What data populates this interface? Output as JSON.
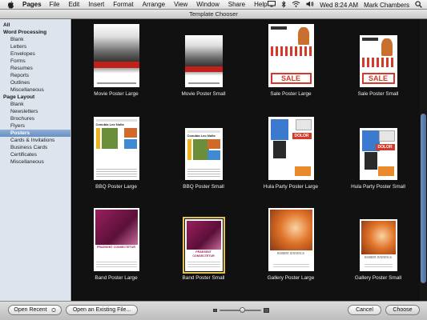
{
  "menubar": {
    "app_name": "Pages",
    "items": [
      "File",
      "Edit",
      "Insert",
      "Format",
      "Arrange",
      "View",
      "Window",
      "Share",
      "Help"
    ],
    "clock": "Wed 8:24 AM",
    "user": "Mark Chambers"
  },
  "window": {
    "title": "Template Chooser"
  },
  "sidebar": {
    "items": [
      {
        "label": "All",
        "header": true
      },
      {
        "label": "Word Processing",
        "header": true
      },
      {
        "label": "Blank"
      },
      {
        "label": "Letters"
      },
      {
        "label": "Envelopes"
      },
      {
        "label": "Forms"
      },
      {
        "label": "Resumes"
      },
      {
        "label": "Reports"
      },
      {
        "label": "Outlines"
      },
      {
        "label": "Miscellaneous"
      },
      {
        "label": "Page Layout",
        "header": true
      },
      {
        "label": "Blank"
      },
      {
        "label": "Newsletters"
      },
      {
        "label": "Brochures"
      },
      {
        "label": "Flyers"
      },
      {
        "label": "Posters",
        "selected": true
      },
      {
        "label": "Cards & Invitations"
      },
      {
        "label": "Business Cards"
      },
      {
        "label": "Certificates"
      },
      {
        "label": "Miscellaneous"
      }
    ]
  },
  "templates": [
    {
      "name": "Movie Poster Large",
      "kind": "movie"
    },
    {
      "name": "Movie Poster Small",
      "kind": "movie"
    },
    {
      "name": "Sale Poster Large",
      "kind": "sale"
    },
    {
      "name": "Sale Poster Small",
      "kind": "sale"
    },
    {
      "name": "BBQ Poster Large",
      "kind": "bbq",
      "heading": "Conubia Leo Nulla"
    },
    {
      "name": "BBQ Poster Small",
      "kind": "bbq",
      "heading": "Conubia Leo Nulla"
    },
    {
      "name": "Hula Party Poster Large",
      "kind": "hula",
      "heading": "DOLOR"
    },
    {
      "name": "Hula Party Poster Small",
      "kind": "hula",
      "heading": "DOLOR"
    },
    {
      "name": "Band Poster Large",
      "kind": "band",
      "heading": "PRAESENT CONSECTETUR"
    },
    {
      "name": "Band Poster Small",
      "kind": "band",
      "heading": "PRAESENT CONSECTETUR",
      "selected": true
    },
    {
      "name": "Gallery Poster Large",
      "kind": "gallery",
      "heading": "ROBERT JENNINGS"
    },
    {
      "name": "Gallery Poster Small",
      "kind": "gallery",
      "heading": "ROBERT JENNINGS"
    }
  ],
  "buttons": {
    "open_recent": "Open Recent",
    "open_existing": "Open an Existing File...",
    "cancel": "Cancel",
    "choose": "Choose"
  },
  "icons": {
    "apple": "apple-icon",
    "display": "display-icon",
    "bluetooth": "bluetooth-icon",
    "wifi": "wifi-icon",
    "volume": "volume-icon",
    "spotlight": "search-icon",
    "thumb_small": "small-thumbnail-icon",
    "thumb_large": "large-thumbnail-icon"
  },
  "colors": {
    "selection_outline": "#e3c14b",
    "sidebar_selection": "#6a8fc2",
    "grid_background": "#111111",
    "sale_red": "#d23a2a",
    "gallery_orange": "#e0742a",
    "band_magenta": "#9b1f5e"
  },
  "zoom": {
    "thumbnail_size_fraction": 0.55
  }
}
